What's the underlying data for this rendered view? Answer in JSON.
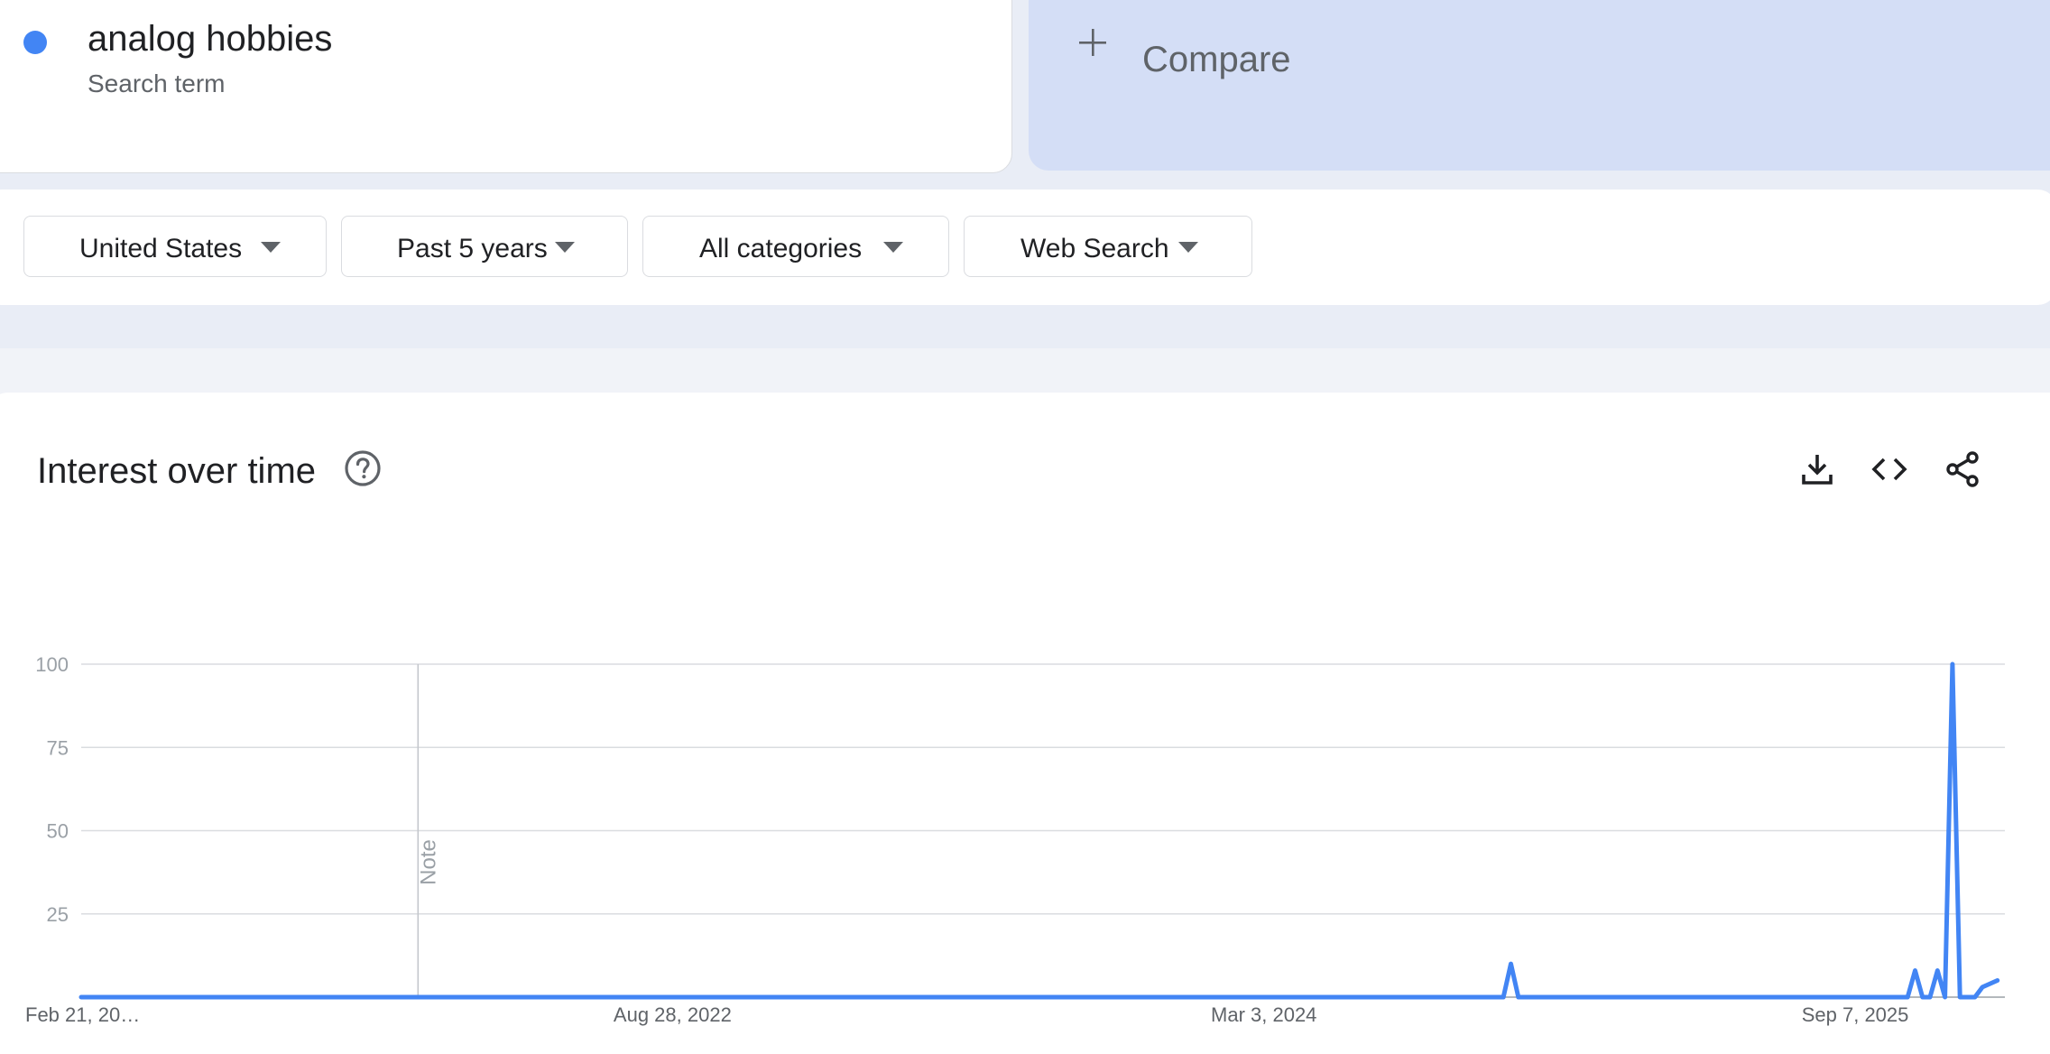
{
  "search_term": {
    "name": "analog hobbies",
    "type": "Search term",
    "color": "#4285f4"
  },
  "compare": {
    "label": "Compare",
    "icon": "plus-icon"
  },
  "filters": [
    {
      "label": "United States",
      "icon": "caret-down-icon"
    },
    {
      "label": "Past 5 years",
      "icon": "caret-down-icon"
    },
    {
      "label": "All categories",
      "icon": "caret-down-icon"
    },
    {
      "label": "Web Search",
      "icon": "caret-down-icon"
    }
  ],
  "chart_panel": {
    "title": "Interest over time",
    "help_icon": "help-circle-icon",
    "actions": [
      "download-icon",
      "embed-code-icon",
      "share-icon"
    ]
  },
  "chart_data": {
    "type": "line",
    "title": "",
    "xlabel": "",
    "ylabel": "",
    "ylim": [
      0,
      100
    ],
    "y_ticks": [
      25,
      50,
      75,
      100
    ],
    "y_tick_labels": [
      "25",
      "50",
      "75",
      "100"
    ],
    "x_range": [
      "2021-02-21",
      "2026-01-25"
    ],
    "x_ticks": [
      {
        "date": "2021-02-21",
        "label": "Feb 21, 20…"
      },
      {
        "date": "2022-08-28",
        "label": "Aug 28, 2022"
      },
      {
        "date": "2024-03-03",
        "label": "Mar 3, 2024"
      },
      {
        "date": "2025-09-07",
        "label": "Sep 7, 2025"
      }
    ],
    "grid": true,
    "annotation": {
      "label": "Note",
      "date": "2022-01-02"
    },
    "series": [
      {
        "color": "#4285f4",
        "points": [
          [
            "2021-02-21",
            0
          ],
          [
            "2024-10-06",
            0
          ],
          [
            "2024-10-13",
            0
          ],
          [
            "2024-10-20",
            10
          ],
          [
            "2024-10-27",
            0
          ],
          [
            "2025-10-19",
            0
          ],
          [
            "2025-10-26",
            0
          ],
          [
            "2025-11-02",
            8
          ],
          [
            "2025-11-09",
            0
          ],
          [
            "2025-11-16",
            0
          ],
          [
            "2025-11-23",
            8
          ],
          [
            "2025-11-30",
            0
          ],
          [
            "2025-12-07",
            100
          ],
          [
            "2025-12-14",
            0
          ],
          [
            "2025-12-21",
            0
          ],
          [
            "2025-12-28",
            0
          ],
          [
            "2026-01-04",
            3
          ],
          [
            "2026-01-18",
            5
          ]
        ]
      }
    ]
  }
}
